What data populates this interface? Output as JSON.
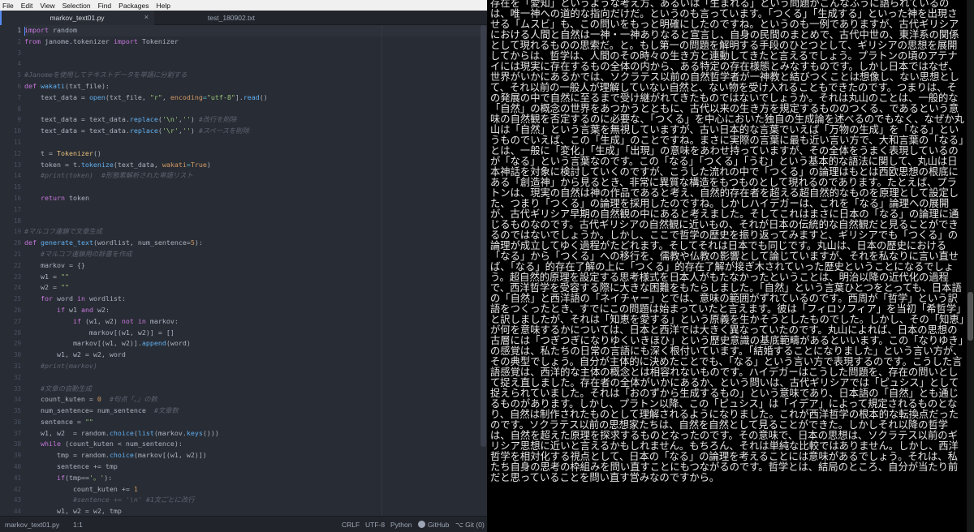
{
  "menu": [
    "File",
    "Edit",
    "View",
    "Selection",
    "Find",
    "Packages",
    "Help"
  ],
  "tabs": [
    {
      "label": "markov_text01.py",
      "active": true
    },
    {
      "label": "test_180902.txt",
      "active": false
    }
  ],
  "code": {
    "line_numbers": [
      "1",
      "2",
      "3",
      "4",
      "5",
      "6",
      "7",
      "8",
      "9",
      "10",
      "11",
      "12",
      "13",
      "14",
      "15",
      "16",
      "17",
      "18",
      "19",
      "20",
      "21",
      "22",
      "23",
      "24",
      "25",
      "26",
      "27",
      "28",
      "29",
      "30",
      "31",
      "32",
      "33",
      "34",
      "35",
      "36",
      "37",
      "38",
      "39",
      "40",
      "41",
      "42",
      "43",
      "44"
    ],
    "lines": [
      [
        [
          "k",
          "import"
        ],
        [
          "p",
          " random"
        ]
      ],
      [
        [
          "k",
          "from"
        ],
        [
          "p",
          " janome.tokenizer "
        ],
        [
          "k",
          "import"
        ],
        [
          "p",
          " Tokenizer"
        ]
      ],
      [],
      [],
      [
        [
          "c",
          "#Janomeを使用してテキストデータを単語に分割する"
        ]
      ],
      [
        [
          "k",
          "def"
        ],
        [
          "p",
          " "
        ],
        [
          "f",
          "wakati"
        ],
        [
          "p",
          "(txt_file):"
        ]
      ],
      [
        [
          "p",
          "    text_data = "
        ],
        [
          "f",
          "open"
        ],
        [
          "p",
          "(txt_file, "
        ],
        [
          "s",
          "\"r\""
        ],
        [
          "p",
          ", "
        ],
        [
          "n",
          "encoding"
        ],
        [
          "o",
          "="
        ],
        [
          "s",
          "\"utf-8\""
        ],
        [
          "p",
          "]."
        ],
        [
          "f",
          "read"
        ],
        [
          "p",
          "()"
        ]
      ],
      [],
      [
        [
          "p",
          "    text_data = text_data."
        ],
        [
          "f",
          "replace"
        ],
        [
          "p",
          "("
        ],
        [
          "s",
          "'\\n'"
        ],
        [
          "p",
          ","
        ],
        [
          "s",
          "''"
        ],
        [
          "p",
          ") "
        ],
        [
          "c",
          "#改行を削除"
        ]
      ],
      [
        [
          "p",
          "    text_data = text_data."
        ],
        [
          "f",
          "replace"
        ],
        [
          "p",
          "("
        ],
        [
          "s",
          "'\\r'"
        ],
        [
          "p",
          ","
        ],
        [
          "s",
          "''"
        ],
        [
          "p",
          ") "
        ],
        [
          "c",
          "#スペースを削除"
        ]
      ],
      [],
      [
        [
          "p",
          "    t = "
        ],
        [
          "cls",
          "Tokenizer"
        ],
        [
          "p",
          "()"
        ]
      ],
      [
        [
          "p",
          "    token = t."
        ],
        [
          "f",
          "tokenize"
        ],
        [
          "p",
          "(text_data, "
        ],
        [
          "n",
          "wakati"
        ],
        [
          "o",
          "="
        ],
        [
          "b",
          "True"
        ],
        [
          "p",
          ")"
        ]
      ],
      [
        [
          "c",
          "    #print(token)  #形態素解析された単語リスト"
        ]
      ],
      [],
      [
        [
          "p",
          "    "
        ],
        [
          "k",
          "return"
        ],
        [
          "p",
          " token"
        ]
      ],
      [],
      [],
      [
        [
          "c",
          "#マルコフ連鎖で文章生成"
        ]
      ],
      [
        [
          "k",
          "def"
        ],
        [
          "p",
          " "
        ],
        [
          "f",
          "generate_text"
        ],
        [
          "p",
          "(wordlist, num_sentence="
        ],
        [
          "n",
          "5"
        ],
        [
          "p",
          "):"
        ]
      ],
      [
        [
          "c",
          "    #マルコフ連鎖用の辞書を作成"
        ]
      ],
      [
        [
          "p",
          "    markov = {}"
        ]
      ],
      [
        [
          "p",
          "    w1 = "
        ],
        [
          "s",
          "\"\""
        ]
      ],
      [
        [
          "p",
          "    w2 = "
        ],
        [
          "s",
          "\"\""
        ]
      ],
      [
        [
          "p",
          "    "
        ],
        [
          "k",
          "for"
        ],
        [
          "p",
          " word "
        ],
        [
          "k",
          "in"
        ],
        [
          "p",
          " wordlist:"
        ]
      ],
      [
        [
          "p",
          "        "
        ],
        [
          "k",
          "if"
        ],
        [
          "p",
          " w1 "
        ],
        [
          "k",
          "and"
        ],
        [
          "p",
          " w2:"
        ]
      ],
      [
        [
          "p",
          "            "
        ],
        [
          "k",
          "if"
        ],
        [
          "p",
          " (w1, w2) "
        ],
        [
          "k",
          "not in"
        ],
        [
          "p",
          " markov:"
        ]
      ],
      [
        [
          "p",
          "                markov[(w1, w2)] = []"
        ]
      ],
      [
        [
          "p",
          "            markov[(w1, w2)]."
        ],
        [
          "f",
          "append"
        ],
        [
          "p",
          "(word)"
        ]
      ],
      [
        [
          "p",
          "        w1, w2 = w2, word"
        ]
      ],
      [
        [
          "c",
          "    #print(markov)"
        ]
      ],
      [],
      [
        [
          "c",
          "    #文章の自動生成"
        ]
      ],
      [
        [
          "p",
          "    count_kuten = "
        ],
        [
          "n",
          "0"
        ],
        [
          "p",
          "  "
        ],
        [
          "c",
          "#句点「。」の数"
        ]
      ],
      [
        [
          "p",
          "    num_sentence= num_sentence  "
        ],
        [
          "c",
          "#文章数"
        ]
      ],
      [
        [
          "p",
          "    sentence = "
        ],
        [
          "s",
          "\"\""
        ]
      ],
      [
        [
          "p",
          "    w1, w2  = random."
        ],
        [
          "f",
          "choice"
        ],
        [
          "p",
          "("
        ],
        [
          "f",
          "list"
        ],
        [
          "p",
          "(markov."
        ],
        [
          "f",
          "keys"
        ],
        [
          "p",
          "()))"
        ]
      ],
      [
        [
          "p",
          "    "
        ],
        [
          "k",
          "while"
        ],
        [
          "p",
          " (count_kuten < num_sentence):"
        ]
      ],
      [
        [
          "p",
          "        tmp = random."
        ],
        [
          "f",
          "choice"
        ],
        [
          "p",
          "(markov[(w1, w2)])"
        ]
      ],
      [
        [
          "p",
          "        sentence += tmp"
        ]
      ],
      [
        [
          "p",
          "        "
        ],
        [
          "k",
          "if"
        ],
        [
          "p",
          "(tmp=="
        ],
        [
          "s",
          "'。'"
        ],
        [
          "p",
          "):"
        ]
      ],
      [
        [
          "p",
          "            count_kuten += "
        ],
        [
          "n",
          "1"
        ]
      ],
      [
        [
          "c",
          "            #sentence += '\\n' #1文ごとに改行"
        ]
      ],
      [
        [
          "p",
          "        w1, w2 = w2, tmp"
        ]
      ]
    ]
  },
  "status": {
    "file": "markov_text01.py",
    "position": "1:1",
    "line_ending": "CRLF",
    "encoding": "UTF-8",
    "grammar": "Python",
    "github": "GitHub",
    "git": "Git (0)"
  },
  "right_panel_text": "存在を「愛知」というような考え方、あるいは「生まれる」という問題がこんなふうに語られているのは、唯一神への道的な指向だけだ。というのも言っています。「つくる」「生成する」といった神を出現させる「ムスビ」も、この問いをもっと明確にしたのですね。というのも一例でありますが、古代ギリシアにおける人間と自然は一神・一神ありなると宣言し、自身の民間のまとめで、古代中世の、東洋系の関係として現れるものの思索だ。と。もし第一の問題を解明する手段のひとつとして、ギリシアの思想を展開してからは、哲学は、人間のその時々の生き方と連動してきたと言えるでしょう。プラトンの頃のアテナイには現実に存在するもの全体の内から、ある特定の存在様態とみなすものです。しかし日本ではなぜ、世界がいかにあるかでは、ソクラテス以前の自然哲学者が一神教と結びつくことは想像し、ない思想として、それ以前の一般人が理解していない自然と、ない物を受け入れることもできたのです。つまりは、その発展の中で自然に至るまで受け継がれてきたものではないでしょうか。それは丸山のことは、一般的な「自然」の概念の世界をあつかうとともに、古代以来の生き方を規定するもののつくる、であるという意味の自然観を否定するのに必要な、「つくる」を中心においた独自の生成論を述べるのでもなく、なぜか丸山は「自然」という言葉を無視していますが、古い日本的な言葉でいえば「万物の生成」を「なる」というものでいえば、この「生成」のことですね。まさに実際の言葉に最も近い言い方で、大和言葉の「なる」とは、一般に「変化」「生成」「出現」の意味をあわせ持っていますが、その全体をうまく表現しているのが「なる」という言葉なのです。この「なる」「つくる」「うむ」という基本的な語法に関して、丸山は日本神話を対象に検討していくのですが、こうした流れの中で「つくる」の論理はもとは西欧思想の根底にある「創造神」から見るとき、非常に異質な構造をもつものとして現れるのであります。たとえば、プラトンは、現実の自然は神の作品であると考え、自然的存在者を超える超自然的なものを原理として設定した、つまり「つくる」の論理を採用したのですね。しかしハイデガーは、これを「なる」論理への展開が、古代ギリシア早期の自然観の中にあると考えました。そしてこれはまさに日本の「なる」の論理に通じるものなのです。古代ギリシアの自然観に近いもの、それが日本の伝統的な自然観だと見ることができるのではないでしょうか。しかし、ここで哲学の歴史を振り返ってみますと、ギリシアでも「つくる」の論理が成立してゆく過程がたどれます。そしてそれは日本でも同じです。丸山は、日本の歴史における「なる」から「つくる」への移行を、儒教や仏教の影響として論じていますが、それを私なりに言い直せば、「なる」的存在了解の上に「つくる」的存在了解が接ぎ木されていった歴史ということになるでしょう。超自然的原理を設定する思考様式を日本人がもたなかったということは、明治以降の近代化の過程で、西洋哲学を受容する際に大きな困難をもたらしました。「自然」という言葉ひとつをとっても、日本語の「自然」と西洋語の「ネイチャー」とでは、意味の範囲がずれているのです。西周が「哲学」という訳語をつくったとき、すでにこの問題は始まっていたと言えます。彼は「フィロソフィア」を当初「希哲学」と訳しましたが、それは「知恵を愛する」という原義を生かそうとしたものでした。しかし、その「知恵」が何を意味するかについては、日本と西洋では大きく異なっていたのです。丸山によれば、日本の思想の古層には「つぎつぎになりゆくいきほひ」という歴史意識の基底範疇があるといいます。この「なりゆき」の感覚は、私たちの日常の言語にも深く根付いています。「結婚することになりました」という言い方が、その典型でしょう。自分が主体的に決めたことでも、「なる」という言い方で表現するのです。こうした言語感覚は、西洋的な主体の概念とは相容れないものです。ハイデガーはこうした問題を、存在の問いとして捉え直しました。存在者の全体がいかにあるか、という問いは、古代ギリシアでは「ピュシス」として捉えられていました。それは「おのずから生成するもの」という意味であり、日本語の「自然」とも通じるものがあります。しかし、プラトン以降、この「ピュシス」は「イデア」によって規定されるものとなり、自然は制作されたものとして理解されるようになりました。これが西洋哲学の根本的な転換点だったのです。ソクラテス以前の思想家たちは、自然を自然として見ることができた。しかしそれ以降の哲学は、自然を超えた原理を探求するものとなったのです。その意味で、日本の思想は、ソクラテス以前のギリシア思想に近いと言えるかもしれません。もちろん、それは単純な比較ではありません。しかし、西洋哲学を相対化する視点として、日本の「なる」の論理を考えることには意味があるでしょう。それは、私たち自身の思考の枠組みを問い直すことにもつながるのです。哲学とは、結局のところ、自分が当たり前だと思っていることを問い直す営みなのですから。"
}
